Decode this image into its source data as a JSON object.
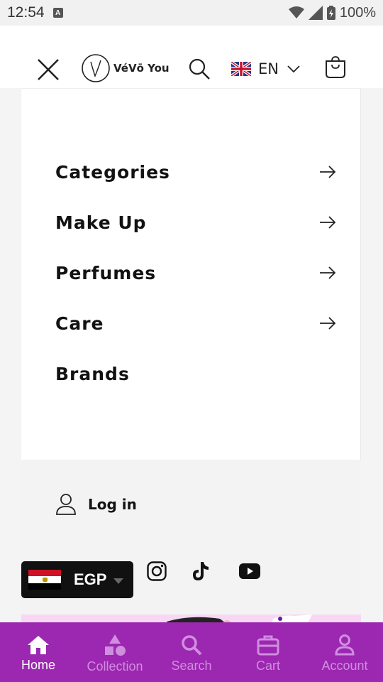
{
  "status_bar": {
    "time": "12:54",
    "notification_letter": "A",
    "battery": "100%"
  },
  "header": {
    "brand": "VéVō You",
    "language": "EN"
  },
  "menu": {
    "items": [
      {
        "label": "Categories",
        "has_arrow": true
      },
      {
        "label": "Make Up",
        "has_arrow": true
      },
      {
        "label": "Perfumes",
        "has_arrow": true
      },
      {
        "label": "Care",
        "has_arrow": true
      },
      {
        "label": "Brands",
        "has_arrow": false
      }
    ]
  },
  "footer": {
    "login_label": "Log in",
    "social": [
      "instagram-icon",
      "tiktok-icon",
      "youtube-icon"
    ]
  },
  "currency": {
    "code": "EGP"
  },
  "bottom_nav": {
    "items": [
      {
        "label": "Home",
        "icon": "home-icon",
        "active": true
      },
      {
        "label": "Collection",
        "icon": "collection-icon",
        "active": false
      },
      {
        "label": "Search",
        "icon": "search-icon",
        "active": false
      },
      {
        "label": "Cart",
        "icon": "cart-icon",
        "active": false
      },
      {
        "label": "Account",
        "icon": "account-icon",
        "active": false
      }
    ]
  },
  "colors": {
    "nav_bg": "#9c27b0",
    "nav_active": "#ffffff",
    "nav_inactive": "#d08ee0",
    "banner_pink": "#f7d7f4"
  }
}
